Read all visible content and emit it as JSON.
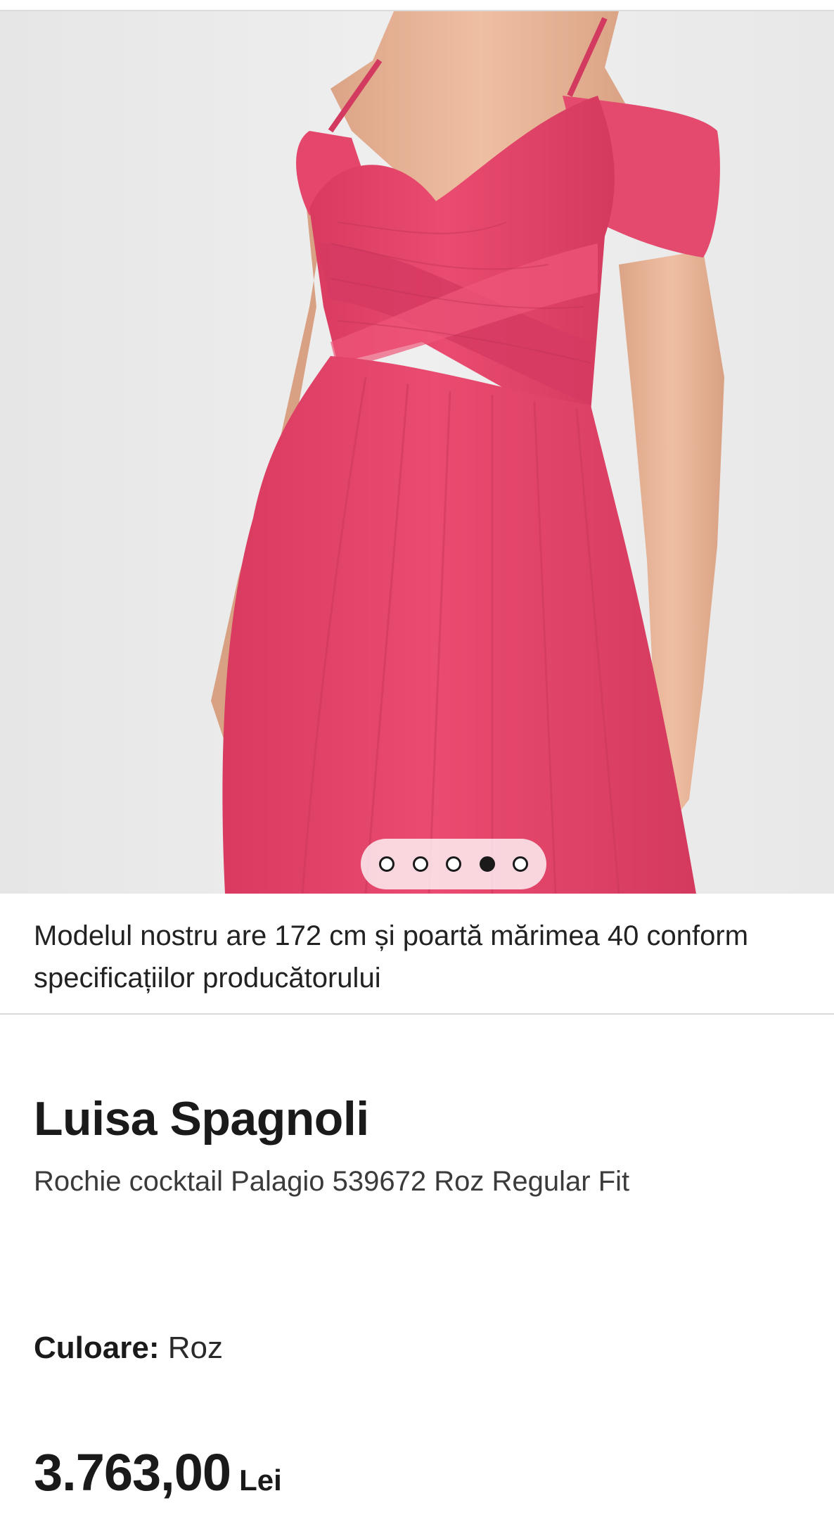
{
  "gallery": {
    "image_subject": "product-photo",
    "slide_count": 5,
    "active_slide_index": 3,
    "slides": [
      "slide-1",
      "slide-2",
      "slide-3",
      "slide-4",
      "slide-5"
    ]
  },
  "model_note": "Modelul nostru are 172 cm și poartă mărimea 40 conform specificațiilor producătorului",
  "product": {
    "brand": "Luisa Spagnoli",
    "name": "Rochie cocktail Palagio 539672 Roz Regular Fit",
    "color_label": "Culoare:",
    "color_value": "Roz",
    "price_value": "3.763,00",
    "price_currency": "Lei"
  },
  "colors": {
    "dress": "#e8456a",
    "background": "#ececec",
    "skin": "#e9b598"
  }
}
